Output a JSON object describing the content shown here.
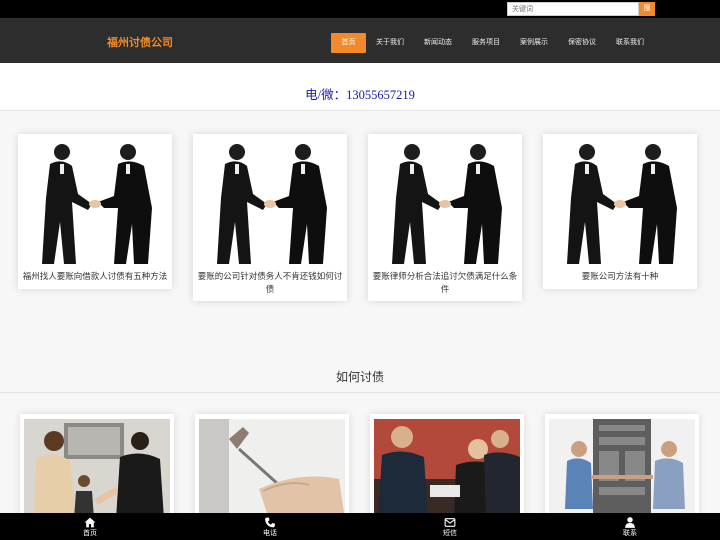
{
  "search": {
    "placeholder": "关键词",
    "button_label": "搜"
  },
  "header": {
    "brand": "福州讨债公司"
  },
  "nav": {
    "items": [
      {
        "label": "首页",
        "active": true
      },
      {
        "label": "关于我们",
        "active": false
      },
      {
        "label": "新闻动态",
        "active": false
      },
      {
        "label": "服务项目",
        "active": false
      },
      {
        "label": "案例展示",
        "active": false
      },
      {
        "label": "保密协议",
        "active": false
      },
      {
        "label": "联系我们",
        "active": false
      }
    ]
  },
  "contact": {
    "phone_line": "电/微：13055657219"
  },
  "articles": [
    {
      "title": "福州找人要账向借款人讨债有五种方法"
    },
    {
      "title": "要账的公司针对债务人不肯还钱如何讨债"
    },
    {
      "title": "要账律师分析合法追讨欠债满足什么条件"
    },
    {
      "title": "要账公司方法有十种"
    }
  ],
  "cases_section": {
    "title": "如何讨债"
  },
  "bottom_nav": {
    "items": [
      {
        "label": "首页",
        "icon": "home-icon"
      },
      {
        "label": "电话",
        "icon": "phone-icon"
      },
      {
        "label": "短信",
        "icon": "envelope-icon"
      },
      {
        "label": "联系",
        "icon": "user-icon"
      }
    ]
  },
  "colors": {
    "accent": "#f08a2a",
    "header_bg": "#2d2d2d",
    "phone_text": "#1a1aa0"
  }
}
